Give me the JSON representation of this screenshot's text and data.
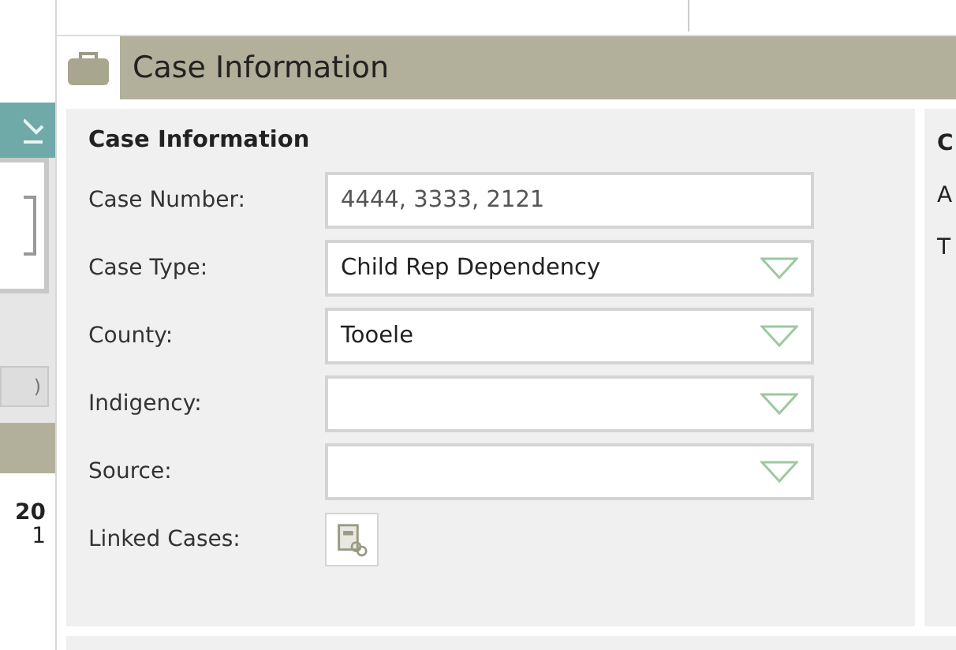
{
  "sidebar": {
    "tab_label": ")",
    "numbers": [
      "20",
      "1"
    ]
  },
  "section": {
    "title": "Case Information"
  },
  "panel": {
    "heading": "Case Information",
    "fields": [
      {
        "kind": "text",
        "label": "Case Number:",
        "value": "4444, 3333, 2121"
      },
      {
        "kind": "select",
        "label": "Case Type:",
        "value": "Child Rep Dependency"
      },
      {
        "kind": "select",
        "label": "County:",
        "value": "Tooele"
      },
      {
        "kind": "select",
        "label": "Indigency:"
      },
      {
        "kind": "select",
        "label": "Source:"
      },
      {
        "kind": "link",
        "label": "Linked Cases:"
      }
    ]
  },
  "side_panel": {
    "lines": [
      "C",
      "A",
      "T"
    ]
  }
}
